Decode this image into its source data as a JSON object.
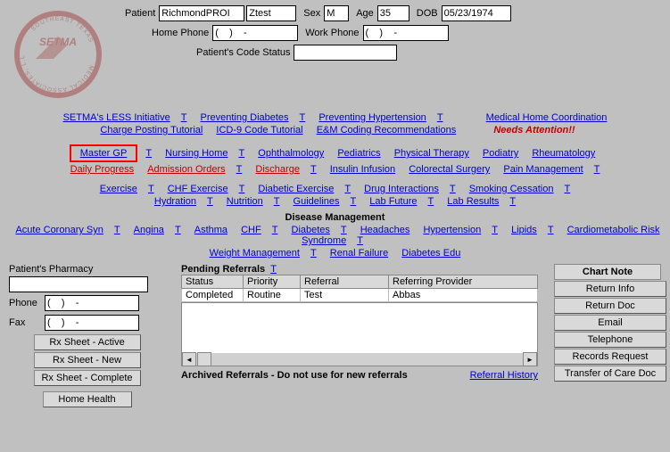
{
  "patient": {
    "label_patient": "Patient",
    "last": "RichmondPROI",
    "first": "Ztest",
    "label_sex": "Sex",
    "sex": "M",
    "label_age": "Age",
    "age": "35",
    "label_dob": "DOB",
    "dob": "05/23/1974",
    "label_home": "Home Phone",
    "home": "(    )    -",
    "label_work": "Work Phone",
    "work": "(    )    -",
    "label_code": "Patient's Code Status",
    "code": ""
  },
  "top_links": {
    "l1": [
      "SETMA's LESS Initiative",
      "Preventing Diabetes",
      "Preventing Hypertension"
    ],
    "mhc": "Medical Home Coordination",
    "needs": "Needs Attention!!",
    "l2": [
      "Charge Posting Tutorial",
      "ICD-9 Code Tutorial",
      "E&M Coding Recommendations"
    ],
    "master": "Master GP",
    "l3": [
      "Nursing Home",
      "Ophthalmology",
      "Pediatrics",
      "Physical Therapy",
      "Podiatry",
      "Rheumatology"
    ],
    "l4": [
      "Daily Progress",
      "Admission Orders",
      "Discharge",
      "Insulin Infusion",
      "Colorectal Surgery",
      "Pain Management"
    ],
    "l5": [
      "Exercise",
      "CHF Exercise",
      "Diabetic Exercise",
      "Drug Interactions",
      "Smoking Cessation"
    ],
    "l6": [
      "Hydration",
      "Nutrition",
      "Guidelines",
      "Lab Future",
      "Lab Results"
    ],
    "dm": "Disease Management",
    "l7": [
      "Acute Coronary Syn",
      "Angina",
      "Asthma",
      "CHF",
      "Diabetes",
      "Headaches",
      "Hypertension",
      "Lipids",
      "Cardiometabolic Risk Syndrome"
    ],
    "l8": [
      "Weight Management",
      "Renal Failure",
      "Diabetes Edu"
    ]
  },
  "pharmacy": {
    "title": "Patient's Pharmacy",
    "name": "",
    "phone_lbl": "Phone",
    "phone": "(    )    -",
    "fax_lbl": "Fax",
    "fax": "(    )    -",
    "b1": "Rx Sheet - Active",
    "b2": "Rx Sheet - New",
    "b3": "Rx Sheet - Complete",
    "b4": "Home Health"
  },
  "pending": {
    "title": "Pending Referrals",
    "cols": [
      "Status",
      "Priority",
      "Referral",
      "Referring Provider"
    ],
    "row": [
      "Completed",
      "Routine",
      "Test",
      "Abbas"
    ],
    "arch": "Archived Referrals - Do not use for new referrals",
    "hist": "Referral History"
  },
  "side": {
    "hd": "Chart Note",
    "b": [
      "Return Info",
      "Return Doc",
      "Email",
      "Telephone",
      "Records Request",
      "Transfer of Care Doc"
    ]
  },
  "T": "T"
}
